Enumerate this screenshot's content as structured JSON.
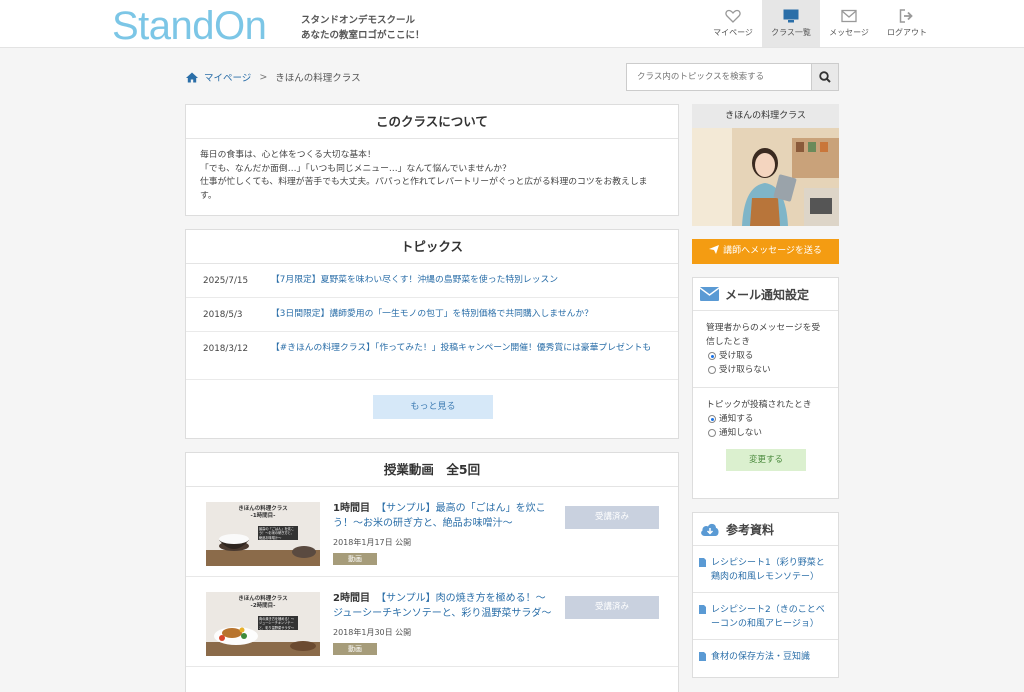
{
  "header": {
    "logo": "StandOn",
    "tagline1": "スタンドオンデモスクール",
    "tagline2": "あなたの教室ロゴがここに！",
    "nav": [
      {
        "label": "マイページ",
        "icon": "heart-icon"
      },
      {
        "label": "クラス一覧",
        "icon": "monitor-icon"
      },
      {
        "label": "メッセージ",
        "icon": "envelope-icon"
      },
      {
        "label": "ログアウト",
        "icon": "logout-icon"
      }
    ]
  },
  "breadcrumb": {
    "home": "マイページ",
    "separator": ">",
    "current": "きほんの料理クラス"
  },
  "search": {
    "placeholder": "クラス内のトピックスを検索する"
  },
  "about": {
    "title": "このクラスについて",
    "lines": [
      "毎日の食事は、心と体をつくる大切な基本！",
      "「でも、なんだか面倒…」「いつも同じメニュー…」なんて悩んでいませんか？",
      "仕事が忙しくても、料理が苦手でも大丈夫。パパっと作れてレパートリーがぐっと広がる料理のコツをお教えします。"
    ]
  },
  "topics": {
    "title": "トピックス",
    "items": [
      {
        "date": "2025/7/15",
        "title": "【7月限定】夏野菜を味わい尽くす！沖縄の島野菜を使った特別レッスン"
      },
      {
        "date": "2018/5/3",
        "title": "【3日間限定】講師愛用の「一生モノの包丁」を特別価格で共同購入しませんか？"
      },
      {
        "date": "2018/3/12",
        "title": "【#きほんの料理クラス】「作ってみた！」投稿キャンペーン開催！優秀賞には豪華プレゼントも"
      }
    ],
    "more": "もっと見る"
  },
  "videos": {
    "title": "授業動画　全5回",
    "items": [
      {
        "thumb_title": "きほんの料理クラス",
        "thumb_sub": "-1時間目-",
        "thumb_note": "最高の「ごはん」を炊こう！～お米の研ぎ方と、絶品お味噌汁～",
        "num": "1時間目",
        "title": "【サンプル】最高の「ごはん」を炊こう！～お米の研ぎ方と、絶品お味噌汁～",
        "date": "2018年1月17日 公開",
        "badge": "動画",
        "status": "受講済み"
      },
      {
        "thumb_title": "きほんの料理クラス",
        "thumb_sub": "-2時間目-",
        "thumb_note": "肉の焼き方を極める！～ジューシーチキンソテーと、彩り温野菜サラダ～",
        "num": "2時間目",
        "title": "【サンプル】肉の焼き方を極める！～ジューシーチキンソテーと、彩り温野菜サラダ～",
        "date": "2018年1月30日 公開",
        "badge": "動画",
        "status": "受講済み"
      }
    ]
  },
  "sidebar": {
    "class_name": "きほんの料理クラス",
    "message_button": "講師へメッセージを送る",
    "mail": {
      "title": "メール通知設定",
      "q1": "管理者からのメッセージを受信したとき",
      "q1_options": [
        "受け取る",
        "受け取らない"
      ],
      "q2": "トピックが投稿されたとき",
      "q2_options": [
        "通知する",
        "通知しない"
      ],
      "submit": "変更する"
    },
    "refs": {
      "title": "参考資料",
      "items": [
        "レシピシート1（彩り野菜と鶏肉の和風レモンソテー）",
        "レシピシート2（きのことベーコンの和風アヒージョ）",
        "食材の保存方法・豆知識"
      ]
    }
  },
  "colors": {
    "accent": "#2a6ea8",
    "orange": "#f49c12",
    "logo": "#7cc6e6"
  }
}
